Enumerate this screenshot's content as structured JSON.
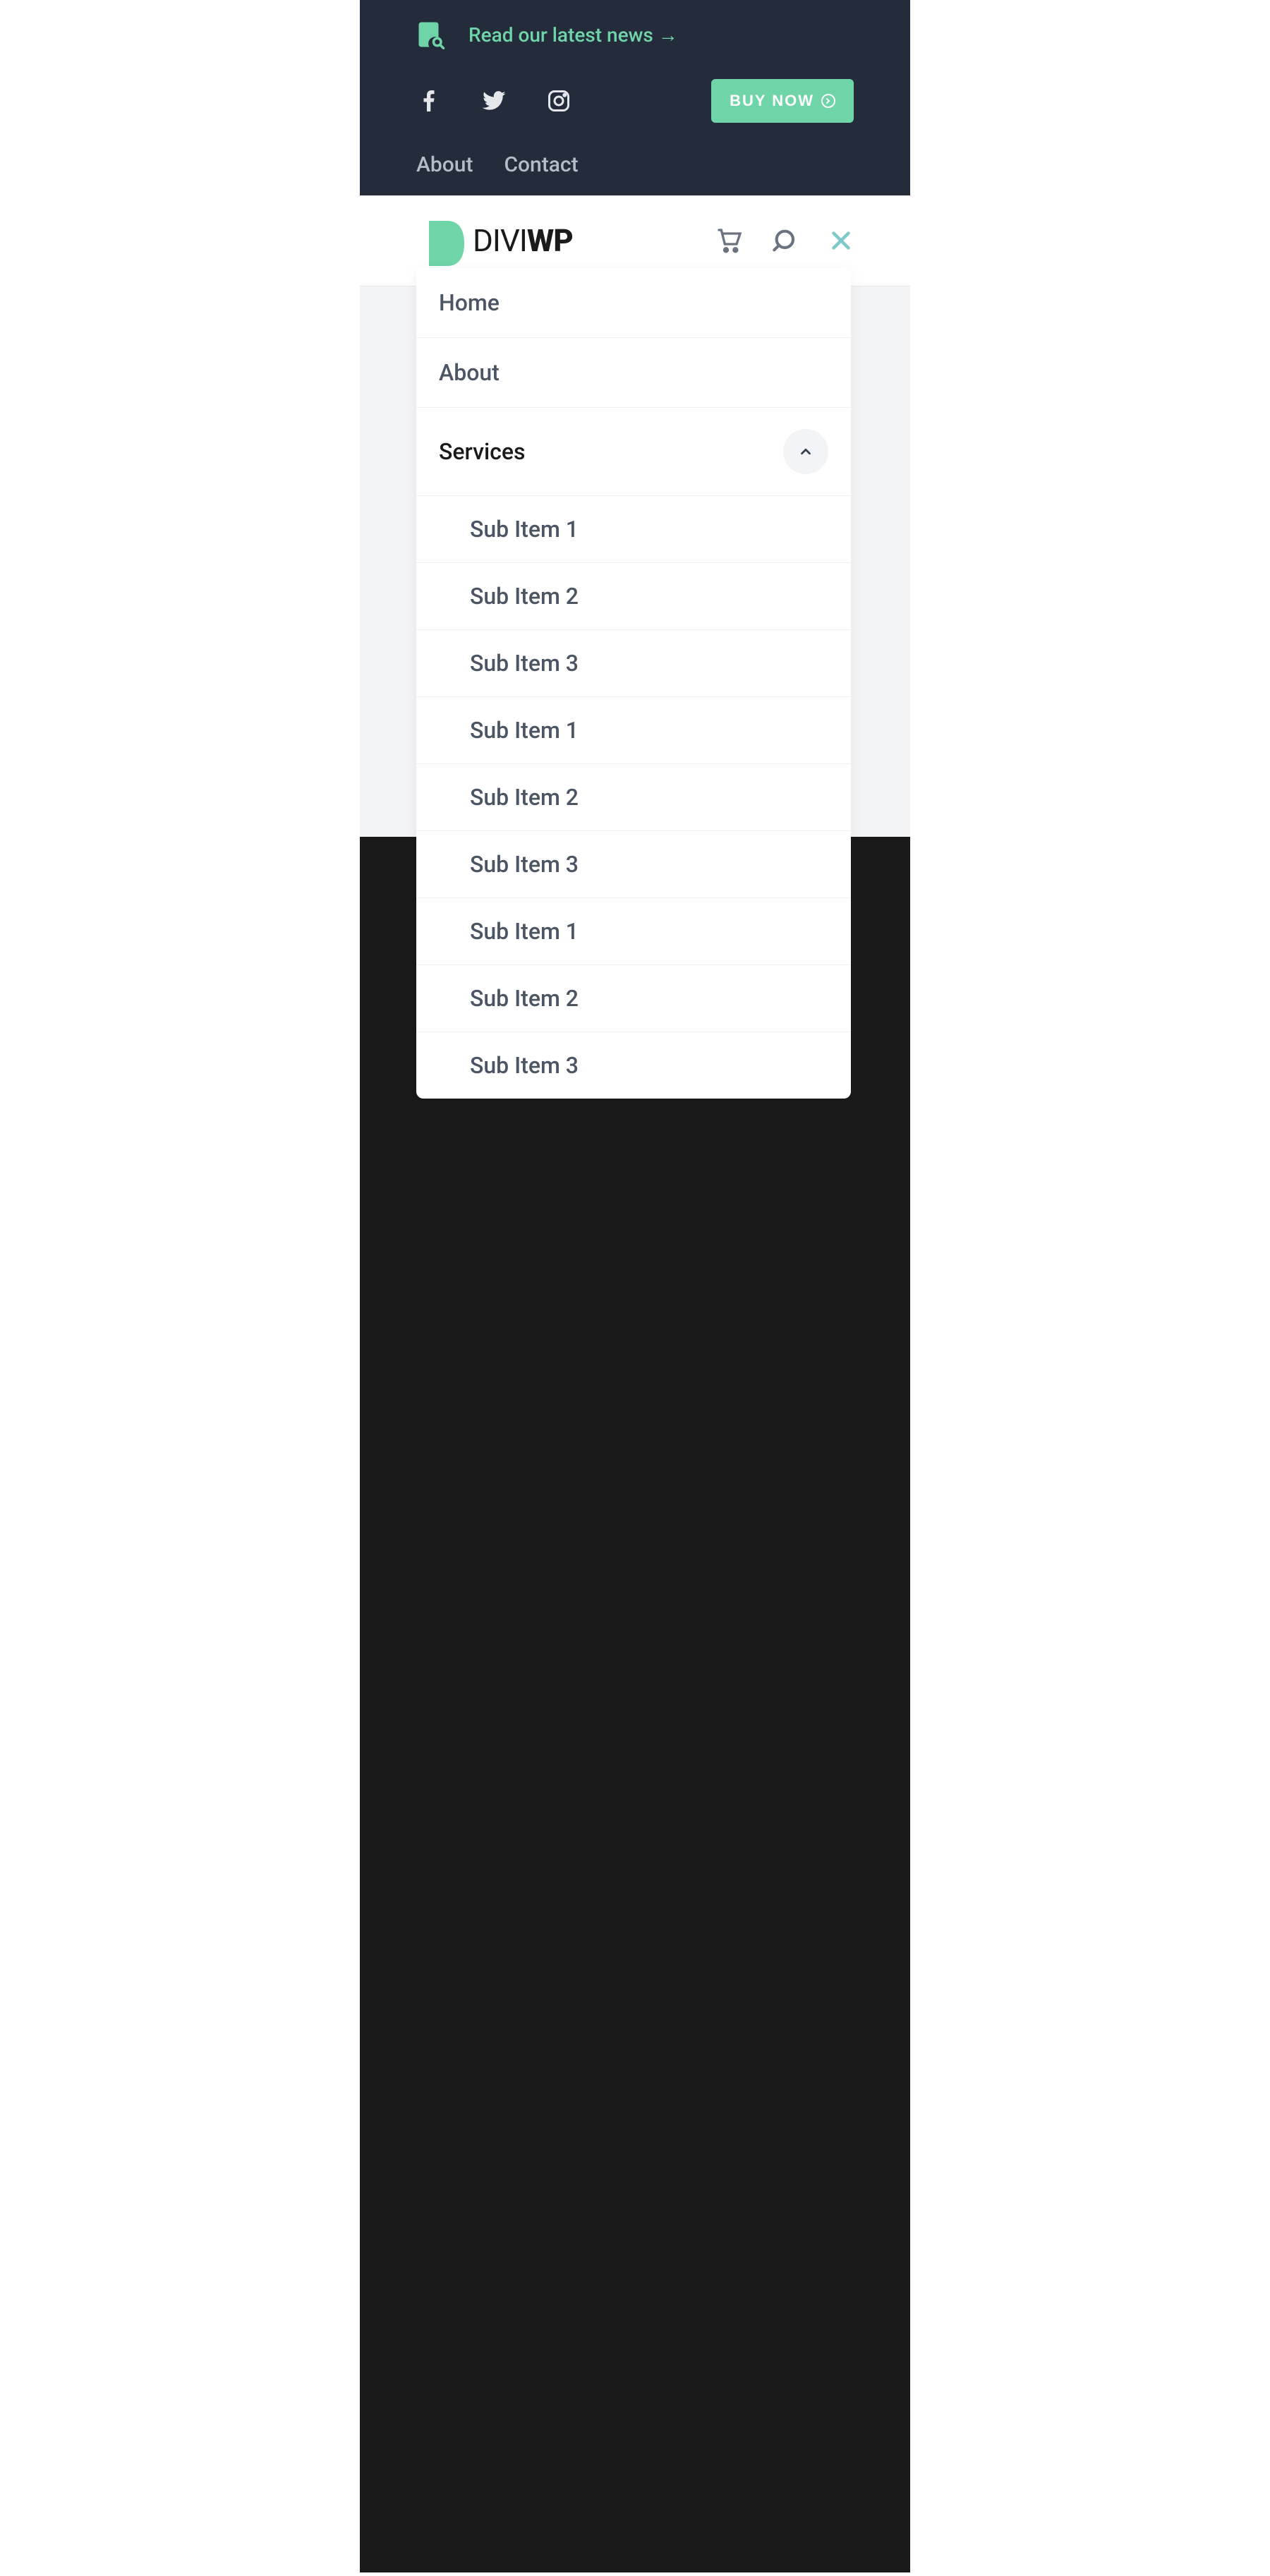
{
  "topbar": {
    "news_link": "Read our latest news →",
    "buy_label": "BUY NOW",
    "nav": [
      "About",
      "Contact"
    ]
  },
  "logo": {
    "part1": "DIVI",
    "part2": "WP"
  },
  "menu": {
    "items": [
      {
        "label": "Home",
        "active": false
      },
      {
        "label": "About",
        "active": false
      },
      {
        "label": "Services",
        "active": true,
        "expanded": true
      }
    ],
    "sub_items": [
      "Sub Item 1",
      "Sub Item 2",
      "Sub Item 3",
      "Sub Item 1",
      "Sub Item 2",
      "Sub Item 3",
      "Sub Item 1",
      "Sub Item 2",
      "Sub Item 3"
    ]
  },
  "colors": {
    "accent": "#6fd4a8",
    "dark_bg": "#242b3a",
    "close_icon": "#7dcbc8",
    "text_muted": "#4b5563"
  }
}
